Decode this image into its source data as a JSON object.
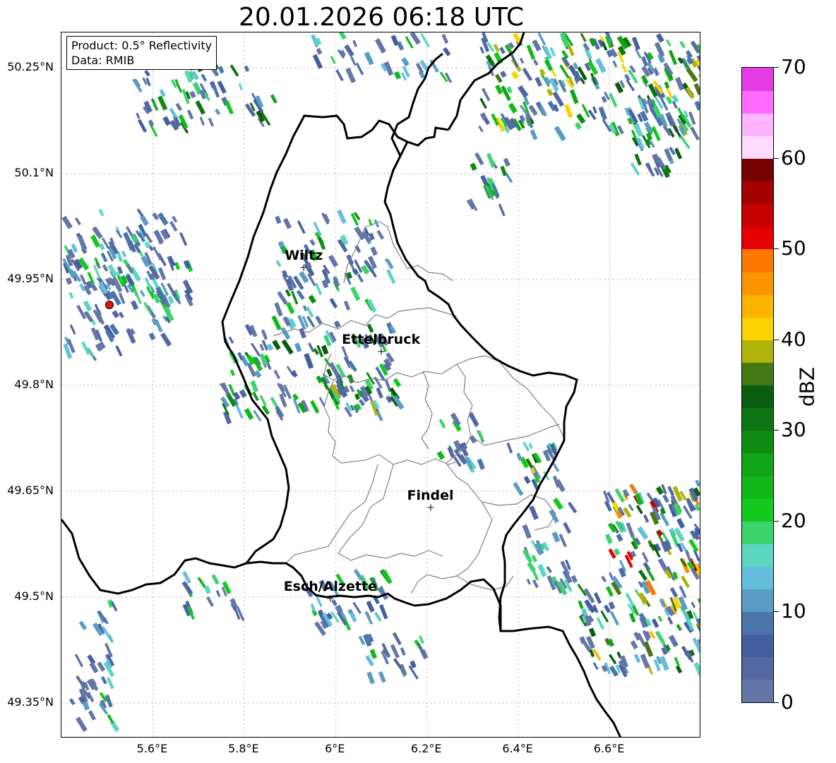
{
  "title": "20.01.2026 06:18 UTC",
  "info": {
    "product": "Product: 0.5° Reflectivity",
    "data_source": "Data: RMIB"
  },
  "axes": {
    "x_ticks": [
      "5.6°E",
      "5.8°E",
      "6°E",
      "6.2°E",
      "6.4°E",
      "6.6°E"
    ],
    "x_values": [
      5.6,
      5.8,
      6.0,
      6.2,
      6.4,
      6.6
    ],
    "y_ticks": [
      "50.25°N",
      "50.1°N",
      "49.95°N",
      "49.8°N",
      "49.65°N",
      "49.5°N",
      "49.35°N"
    ],
    "y_values": [
      50.25,
      50.1,
      49.95,
      49.8,
      49.65,
      49.5,
      49.35
    ],
    "lon_range": [
      5.4,
      6.8
    ],
    "lat_range": [
      49.3,
      50.3
    ],
    "grid": true
  },
  "cities": [
    {
      "name": "Wiltz",
      "lon": 5.932,
      "lat": 49.966
    },
    {
      "name": "Ettelbruck",
      "lon": 6.101,
      "lat": 49.847
    },
    {
      "name": "Findel",
      "lon": 6.209,
      "lat": 49.626
    },
    {
      "name": "Esch/Alzette",
      "lon": 5.99,
      "lat": 49.497
    }
  ],
  "radar_site": {
    "lon": 5.505,
    "lat": 49.914,
    "color": "#e8110f"
  },
  "colorbar": {
    "label": "dBZ",
    "min": 0,
    "max": 70,
    "tick_values": [
      0,
      10,
      20,
      30,
      40,
      50,
      60,
      70
    ],
    "tick_labels": [
      "0",
      "10",
      "20",
      "30",
      "40",
      "50",
      "60",
      "70"
    ],
    "colors": [
      "#6476a8",
      "#5367a3",
      "#445ea0",
      "#4a74aa",
      "#5a9cc4",
      "#64bfdc",
      "#5cd6c0",
      "#3cd46c",
      "#14c81e",
      "#12b81a",
      "#10a416",
      "#0e8c12",
      "#0c7410",
      "#0a5c0e",
      "#467814",
      "#b0b40a",
      "#fcd200",
      "#fcb400",
      "#fc9600",
      "#fc7800",
      "#e40000",
      "#c40000",
      "#a40000",
      "#780000",
      "#ffdcff",
      "#ffb4ff",
      "#ff6cff",
      "#e43ce4"
    ]
  }
}
